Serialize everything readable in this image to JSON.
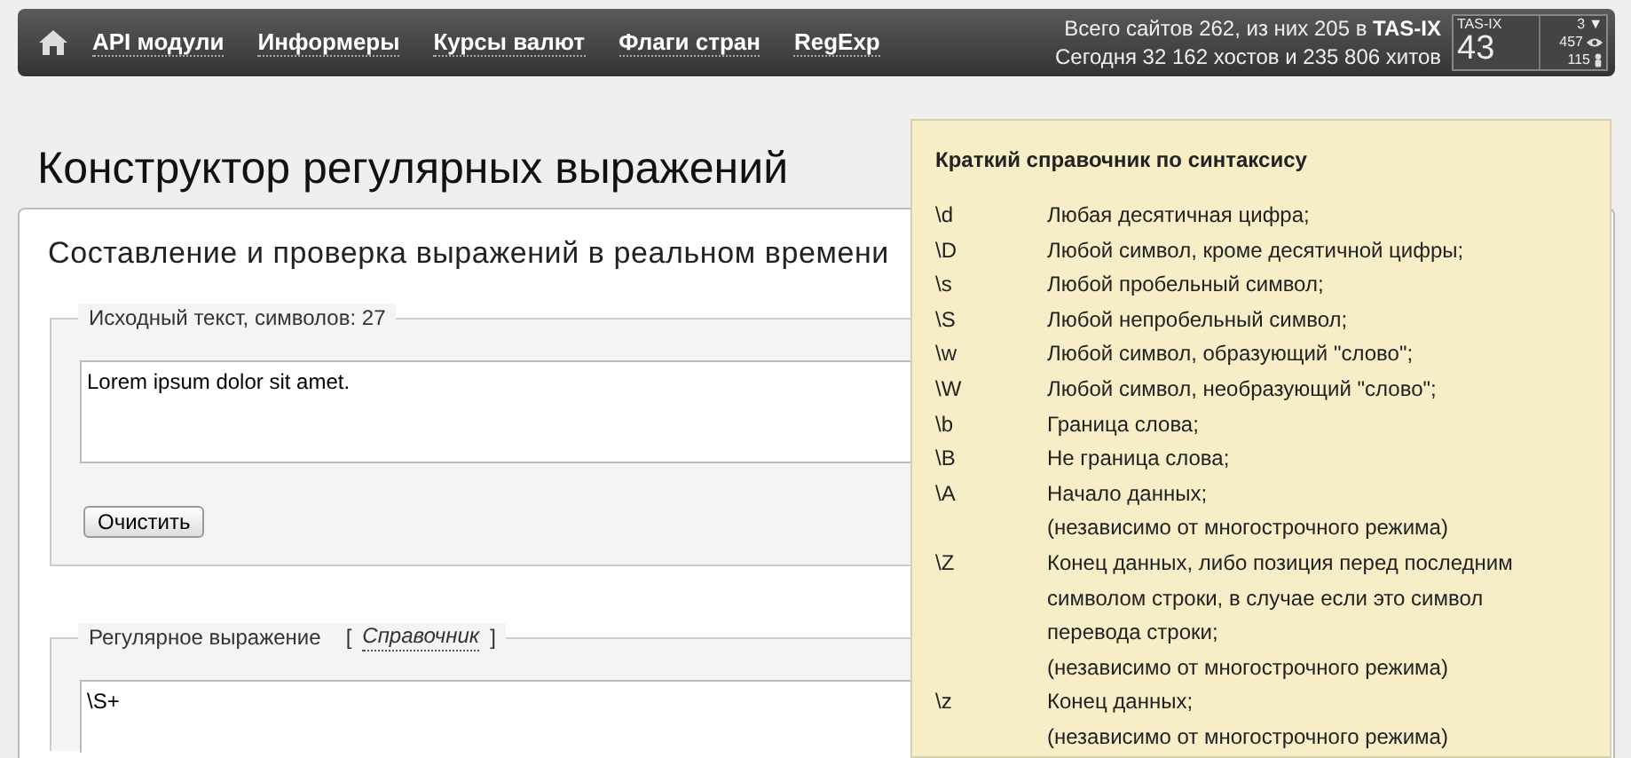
{
  "topbar": {
    "nav": [
      "API модули",
      "Информеры",
      "Курсы валют",
      "Флаги стран",
      "RegExp"
    ],
    "stats": [
      "Всего сайтов 262, из них 205 в **TAS-IX**",
      "Сегодня 32 162 хостов и 235 806 хитов"
    ],
    "counter": {
      "label": "TAS-IX",
      "value": "43",
      "rows": [
        {
          "kind": "down",
          "value": "3",
          "glyph": "▼"
        },
        {
          "kind": "views",
          "value": "457"
        },
        {
          "kind": "visitors",
          "value": "115"
        }
      ]
    }
  },
  "page_title": "Конструктор регулярных выражений",
  "subtitle": "Составление и проверка выражений в реальном времени",
  "source": {
    "legend": "Исходный текст, символов: 27",
    "value": "Lorem ipsum dolor sit amet.",
    "button": "Очистить"
  },
  "regex": {
    "legend": "Регулярное выражение",
    "open_bracket": "[",
    "link": "Справочник",
    "close_bracket": "]",
    "value": "\\S+"
  },
  "reference": {
    "title": "Краткий справочник по синтаксису",
    "entries": [
      {
        "key": "\\d",
        "lines": [
          "Любая десятичная цифра;"
        ]
      },
      {
        "key": "\\D",
        "lines": [
          "Любой символ, кроме десятичной цифры;"
        ]
      },
      {
        "key": "\\s",
        "lines": [
          "Любой пробельный символ;"
        ]
      },
      {
        "key": "\\S",
        "lines": [
          "Любой непробельный символ;"
        ]
      },
      {
        "key": "\\w",
        "lines": [
          "Любой символ, образующий \"слово\";"
        ]
      },
      {
        "key": "\\W",
        "lines": [
          "Любой символ, необразующий \"слово\";"
        ]
      },
      {
        "key": "\\b",
        "lines": [
          "Граница слова;"
        ]
      },
      {
        "key": "\\B",
        "lines": [
          "Не граница слова;"
        ]
      },
      {
        "key": "\\A",
        "lines": [
          "Начало данных;",
          "(независимо от многострочного режима)"
        ]
      },
      {
        "key": "\\Z",
        "lines": [
          "Конец данных, либо позиция перед последним",
          "символом строки, в случае если это символ",
          "перевода строки;",
          "(независимо от многострочного режима)"
        ]
      },
      {
        "key": "\\z",
        "lines": [
          "Конец данных;",
          "(независимо от многострочного режима)"
        ]
      }
    ]
  }
}
